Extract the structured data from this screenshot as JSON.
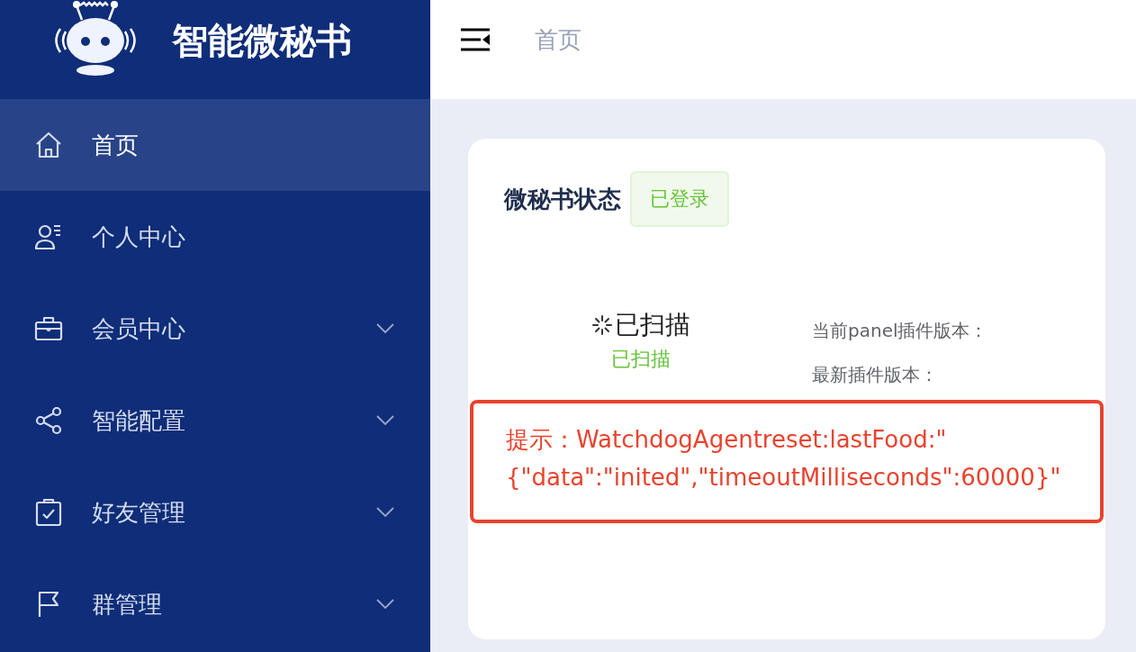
{
  "sidebar": {
    "title": "智能微秘书",
    "items": [
      {
        "label": "首页",
        "selected": true,
        "expandable": false
      },
      {
        "label": "个人中心",
        "selected": false,
        "expandable": false
      },
      {
        "label": "会员中心",
        "selected": false,
        "expandable": true
      },
      {
        "label": "智能配置",
        "selected": false,
        "expandable": true
      },
      {
        "label": "好友管理",
        "selected": false,
        "expandable": true
      },
      {
        "label": "群管理",
        "selected": false,
        "expandable": true
      }
    ]
  },
  "header": {
    "breadcrumb": "首页"
  },
  "card": {
    "title": "微秘书状态",
    "tag": "已登录",
    "scan": {
      "status": "已扫描",
      "caption": "已扫描"
    },
    "info": [
      "当前panel插件版本：",
      "最新插件版本："
    ],
    "alert": "提示：WatchdogAgentreset:lastFood:\"{\"data\":\"inited\",\"timeoutMilliseconds\":60000}\""
  }
}
